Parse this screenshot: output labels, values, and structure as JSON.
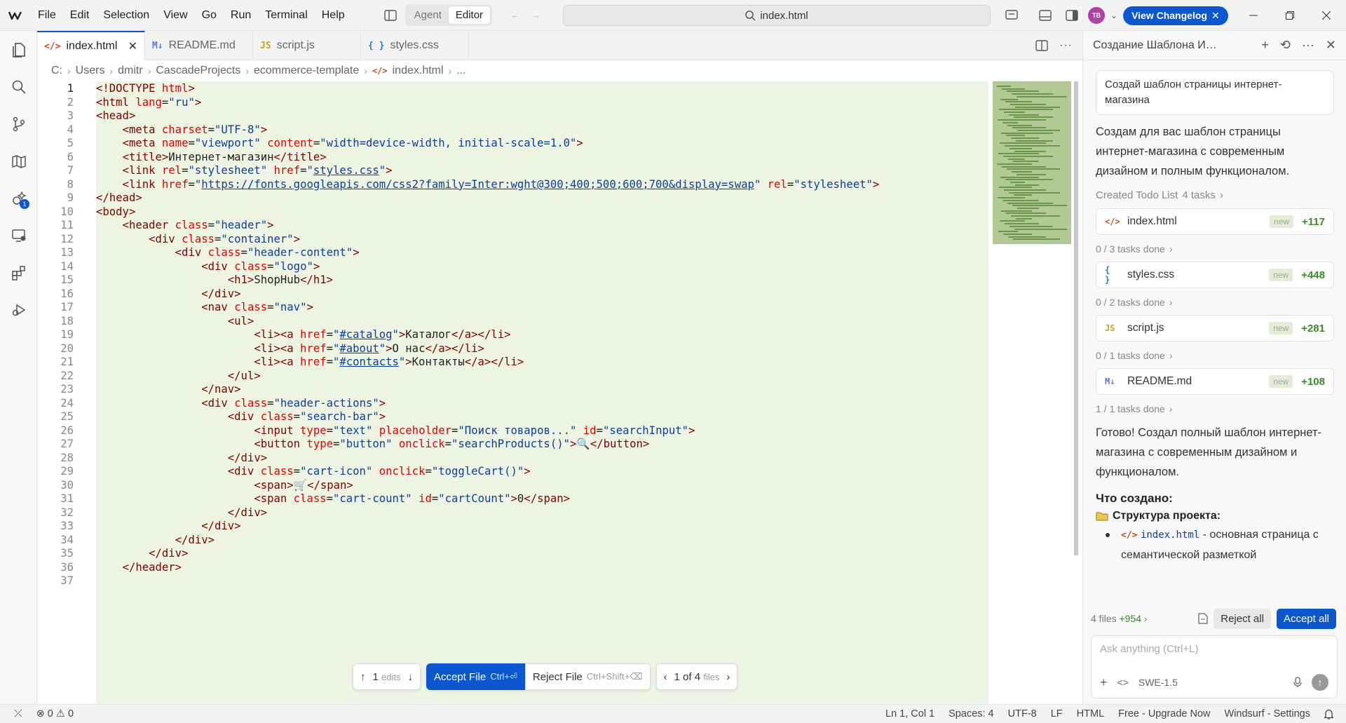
{
  "menu": [
    "File",
    "Edit",
    "Selection",
    "View",
    "Go",
    "Run",
    "Terminal",
    "Help"
  ],
  "mode": {
    "agent": "Agent",
    "editor": "Editor"
  },
  "search": {
    "text": "index.html"
  },
  "avatar": "TB",
  "changelog": "View Changelog",
  "tabs": [
    {
      "icon": "</>",
      "label": "index.html",
      "active": true
    },
    {
      "icon": "M↓",
      "label": "README.md"
    },
    {
      "icon": "JS",
      "label": "script.js"
    },
    {
      "icon": "{ }",
      "label": "styles.css"
    }
  ],
  "breadcrumb": [
    "C:",
    "Users",
    "dmitr",
    "CascadeProjects",
    "ecommerce-template",
    "index.html",
    "..."
  ],
  "code": [
    [
      [
        "tag",
        "<!DOCTYPE "
      ],
      [
        "attr",
        "html"
      ],
      [
        "tag",
        ">"
      ]
    ],
    [
      [
        "tag",
        "<html "
      ],
      [
        "attr",
        "lang"
      ],
      [
        "txt",
        "="
      ],
      [
        "str",
        "\"ru\""
      ],
      [
        "tag",
        ">"
      ]
    ],
    [
      [
        "tag",
        "<head>"
      ]
    ],
    [
      [
        "txt",
        "    "
      ],
      [
        "tag",
        "<meta "
      ],
      [
        "attr",
        "charset"
      ],
      [
        "txt",
        "="
      ],
      [
        "str",
        "\"UTF-8\""
      ],
      [
        "tag",
        ">"
      ]
    ],
    [
      [
        "txt",
        "    "
      ],
      [
        "tag",
        "<meta "
      ],
      [
        "attr",
        "name"
      ],
      [
        "txt",
        "="
      ],
      [
        "str",
        "\"viewport\""
      ],
      [
        "txt",
        " "
      ],
      [
        "attr",
        "content"
      ],
      [
        "txt",
        "="
      ],
      [
        "str",
        "\"width=device-width, initial-scale=1.0\""
      ],
      [
        "tag",
        ">"
      ]
    ],
    [
      [
        "txt",
        "    "
      ],
      [
        "tag",
        "<title>"
      ],
      [
        "txt",
        "Интернет-магазин"
      ],
      [
        "tag",
        "</title>"
      ]
    ],
    [
      [
        "txt",
        "    "
      ],
      [
        "tag",
        "<link "
      ],
      [
        "attr",
        "rel"
      ],
      [
        "txt",
        "="
      ],
      [
        "str",
        "\"stylesheet\""
      ],
      [
        "txt",
        " "
      ],
      [
        "attr",
        "href"
      ],
      [
        "txt",
        "="
      ],
      [
        "str",
        "\""
      ],
      [
        "lnk",
        "styles.css"
      ],
      [
        "str",
        "\""
      ],
      [
        "tag",
        ">"
      ]
    ],
    [
      [
        "txt",
        "    "
      ],
      [
        "tag",
        "<link "
      ],
      [
        "attr",
        "href"
      ],
      [
        "txt",
        "="
      ],
      [
        "str",
        "\""
      ],
      [
        "lnk",
        "https://fonts.googleapis.com/css2?family=Inter:wght@300;400;500;600;700&display=swap"
      ],
      [
        "str",
        "\""
      ],
      [
        "txt",
        " "
      ],
      [
        "attr",
        "rel"
      ],
      [
        "txt",
        "="
      ],
      [
        "str",
        "\"stylesheet\""
      ],
      [
        "tag",
        ">"
      ]
    ],
    [
      [
        "tag",
        "</head>"
      ]
    ],
    [
      [
        "tag",
        "<body>"
      ]
    ],
    [
      [
        "txt",
        "    "
      ],
      [
        "tag",
        "<header "
      ],
      [
        "attr",
        "class"
      ],
      [
        "txt",
        "="
      ],
      [
        "str",
        "\"header\""
      ],
      [
        "tag",
        ">"
      ]
    ],
    [
      [
        "txt",
        "        "
      ],
      [
        "tag",
        "<div "
      ],
      [
        "attr",
        "class"
      ],
      [
        "txt",
        "="
      ],
      [
        "str",
        "\"container\""
      ],
      [
        "tag",
        ">"
      ]
    ],
    [
      [
        "txt",
        "            "
      ],
      [
        "tag",
        "<div "
      ],
      [
        "attr",
        "class"
      ],
      [
        "txt",
        "="
      ],
      [
        "str",
        "\"header-content\""
      ],
      [
        "tag",
        ">"
      ]
    ],
    [
      [
        "txt",
        "                "
      ],
      [
        "tag",
        "<div "
      ],
      [
        "attr",
        "class"
      ],
      [
        "txt",
        "="
      ],
      [
        "str",
        "\"logo\""
      ],
      [
        "tag",
        ">"
      ]
    ],
    [
      [
        "txt",
        "                    "
      ],
      [
        "tag",
        "<h1>"
      ],
      [
        "txt",
        "ShopHub"
      ],
      [
        "tag",
        "</h1>"
      ]
    ],
    [
      [
        "txt",
        "                "
      ],
      [
        "tag",
        "</div>"
      ]
    ],
    [
      [
        "txt",
        "                "
      ],
      [
        "tag",
        "<nav "
      ],
      [
        "attr",
        "class"
      ],
      [
        "txt",
        "="
      ],
      [
        "str",
        "\"nav\""
      ],
      [
        "tag",
        ">"
      ]
    ],
    [
      [
        "txt",
        "                    "
      ],
      [
        "tag",
        "<ul>"
      ]
    ],
    [
      [
        "txt",
        "                        "
      ],
      [
        "tag",
        "<li><a "
      ],
      [
        "attr",
        "href"
      ],
      [
        "txt",
        "="
      ],
      [
        "str",
        "\""
      ],
      [
        "lnk",
        "#catalog"
      ],
      [
        "str",
        "\""
      ],
      [
        "tag",
        ">"
      ],
      [
        "txt",
        "Каталог"
      ],
      [
        "tag",
        "</a></li>"
      ]
    ],
    [
      [
        "txt",
        "                        "
      ],
      [
        "tag",
        "<li><a "
      ],
      [
        "attr",
        "href"
      ],
      [
        "txt",
        "="
      ],
      [
        "str",
        "\""
      ],
      [
        "lnk",
        "#about"
      ],
      [
        "str",
        "\""
      ],
      [
        "tag",
        ">"
      ],
      [
        "txt",
        "О нас"
      ],
      [
        "tag",
        "</a></li>"
      ]
    ],
    [
      [
        "txt",
        "                        "
      ],
      [
        "tag",
        "<li><a "
      ],
      [
        "attr",
        "href"
      ],
      [
        "txt",
        "="
      ],
      [
        "str",
        "\""
      ],
      [
        "lnk",
        "#contacts"
      ],
      [
        "str",
        "\""
      ],
      [
        "tag",
        ">"
      ],
      [
        "txt",
        "Контакты"
      ],
      [
        "tag",
        "</a></li>"
      ]
    ],
    [
      [
        "txt",
        "                    "
      ],
      [
        "tag",
        "</ul>"
      ]
    ],
    [
      [
        "txt",
        "                "
      ],
      [
        "tag",
        "</nav>"
      ]
    ],
    [
      [
        "txt",
        "                "
      ],
      [
        "tag",
        "<div "
      ],
      [
        "attr",
        "class"
      ],
      [
        "txt",
        "="
      ],
      [
        "str",
        "\"header-actions\""
      ],
      [
        "tag",
        ">"
      ]
    ],
    [
      [
        "txt",
        "                    "
      ],
      [
        "tag",
        "<div "
      ],
      [
        "attr",
        "class"
      ],
      [
        "txt",
        "="
      ],
      [
        "str",
        "\"search-bar\""
      ],
      [
        "tag",
        ">"
      ]
    ],
    [
      [
        "txt",
        "                        "
      ],
      [
        "tag",
        "<input "
      ],
      [
        "attr",
        "type"
      ],
      [
        "txt",
        "="
      ],
      [
        "str",
        "\"text\""
      ],
      [
        "txt",
        " "
      ],
      [
        "attr",
        "placeholder"
      ],
      [
        "txt",
        "="
      ],
      [
        "str",
        "\"Поиск товаров...\""
      ],
      [
        "txt",
        " "
      ],
      [
        "attr",
        "id"
      ],
      [
        "txt",
        "="
      ],
      [
        "str",
        "\"searchInput\""
      ],
      [
        "tag",
        ">"
      ]
    ],
    [
      [
        "txt",
        "                        "
      ],
      [
        "tag",
        "<button "
      ],
      [
        "attr",
        "type"
      ],
      [
        "txt",
        "="
      ],
      [
        "str",
        "\"button\""
      ],
      [
        "txt",
        " "
      ],
      [
        "attr",
        "onclick"
      ],
      [
        "txt",
        "="
      ],
      [
        "str",
        "\"searchProducts()\""
      ],
      [
        "tag",
        ">"
      ],
      [
        "txt",
        "🔍"
      ],
      [
        "tag",
        "</button>"
      ]
    ],
    [
      [
        "txt",
        "                    "
      ],
      [
        "tag",
        "</div>"
      ]
    ],
    [
      [
        "txt",
        "                    "
      ],
      [
        "tag",
        "<div "
      ],
      [
        "attr",
        "class"
      ],
      [
        "txt",
        "="
      ],
      [
        "str",
        "\"cart-icon\""
      ],
      [
        "txt",
        " "
      ],
      [
        "attr",
        "onclick"
      ],
      [
        "txt",
        "="
      ],
      [
        "str",
        "\"toggleCart()\""
      ],
      [
        "tag",
        ">"
      ]
    ],
    [
      [
        "txt",
        "                        "
      ],
      [
        "tag",
        "<span>"
      ],
      [
        "txt",
        "🛒"
      ],
      [
        "tag",
        "</span>"
      ]
    ],
    [
      [
        "txt",
        "                        "
      ],
      [
        "tag",
        "<span "
      ],
      [
        "attr",
        "class"
      ],
      [
        "txt",
        "="
      ],
      [
        "str",
        "\"cart-count\""
      ],
      [
        "txt",
        " "
      ],
      [
        "attr",
        "id"
      ],
      [
        "txt",
        "="
      ],
      [
        "str",
        "\"cartCount\""
      ],
      [
        "tag",
        ">"
      ],
      [
        "txt",
        "0"
      ],
      [
        "tag",
        "</span>"
      ]
    ],
    [
      [
        "txt",
        "                    "
      ],
      [
        "tag",
        "</div>"
      ]
    ],
    [
      [
        "txt",
        "                "
      ],
      [
        "tag",
        "</div>"
      ]
    ],
    [
      [
        "txt",
        "            "
      ],
      [
        "tag",
        "</div>"
      ]
    ],
    [
      [
        "txt",
        "        "
      ],
      [
        "tag",
        "</div>"
      ]
    ],
    [
      [
        "txt",
        "    "
      ],
      [
        "tag",
        "</header>"
      ]
    ],
    [
      [
        "txt",
        ""
      ]
    ]
  ],
  "floatbar": {
    "edits": "1",
    "edits_label": "edits",
    "accept": "Accept File",
    "accept_kbd": "Ctrl+⏎",
    "reject": "Reject File",
    "reject_kbd": "Ctrl+Shift+⌫",
    "pager": "1 of 4",
    "pager_suffix": "files"
  },
  "panel": {
    "title": "Создание Шаблона Интернет-магазина",
    "user_msg": "Создай шаблон страницы интернет-магазина",
    "intro": "Создам для вас шаблон страницы интернет-магазина с современным дизайном и полным функционалом.",
    "todo_label": "Created Todo List",
    "todo_count": "4 tasks",
    "files": [
      {
        "icon": "</>",
        "name": "index.html",
        "tag": "new",
        "plus": "+117",
        "progress": "0 / 3 tasks done"
      },
      {
        "icon": "{ }",
        "name": "styles.css",
        "tag": "new",
        "plus": "+448",
        "progress": "0 / 2 tasks done"
      },
      {
        "icon": "JS",
        "name": "script.js",
        "tag": "new",
        "plus": "+281",
        "progress": "0 / 1 tasks done"
      },
      {
        "icon": "M↓",
        "name": "README.md",
        "tag": "new",
        "plus": "+108",
        "progress": "1 / 1 tasks done"
      }
    ],
    "done_text": "Готово! Создал полный шаблон интернет-магазина с современным дизайном и функционалом.",
    "created_h": "Что создано:",
    "structure_h": "Структура проекта:",
    "bullet_code": "index.html",
    "bullet_text": " - основная страница с семантической разметкой",
    "summary_files": "4 files",
    "summary_plus": "+954",
    "reject_all": "Reject all",
    "accept_all": "Accept all",
    "input_placeholder": "Ask anything (Ctrl+L)",
    "model": "SWE-1.5"
  },
  "status": {
    "errors": "0",
    "warnings": "0",
    "pos": "Ln 1, Col 1",
    "spaces": "Spaces: 4",
    "enc": "UTF-8",
    "eol": "LF",
    "lang": "HTML",
    "plan": "Free - Upgrade Now",
    "settings": "Windsurf - Settings"
  }
}
